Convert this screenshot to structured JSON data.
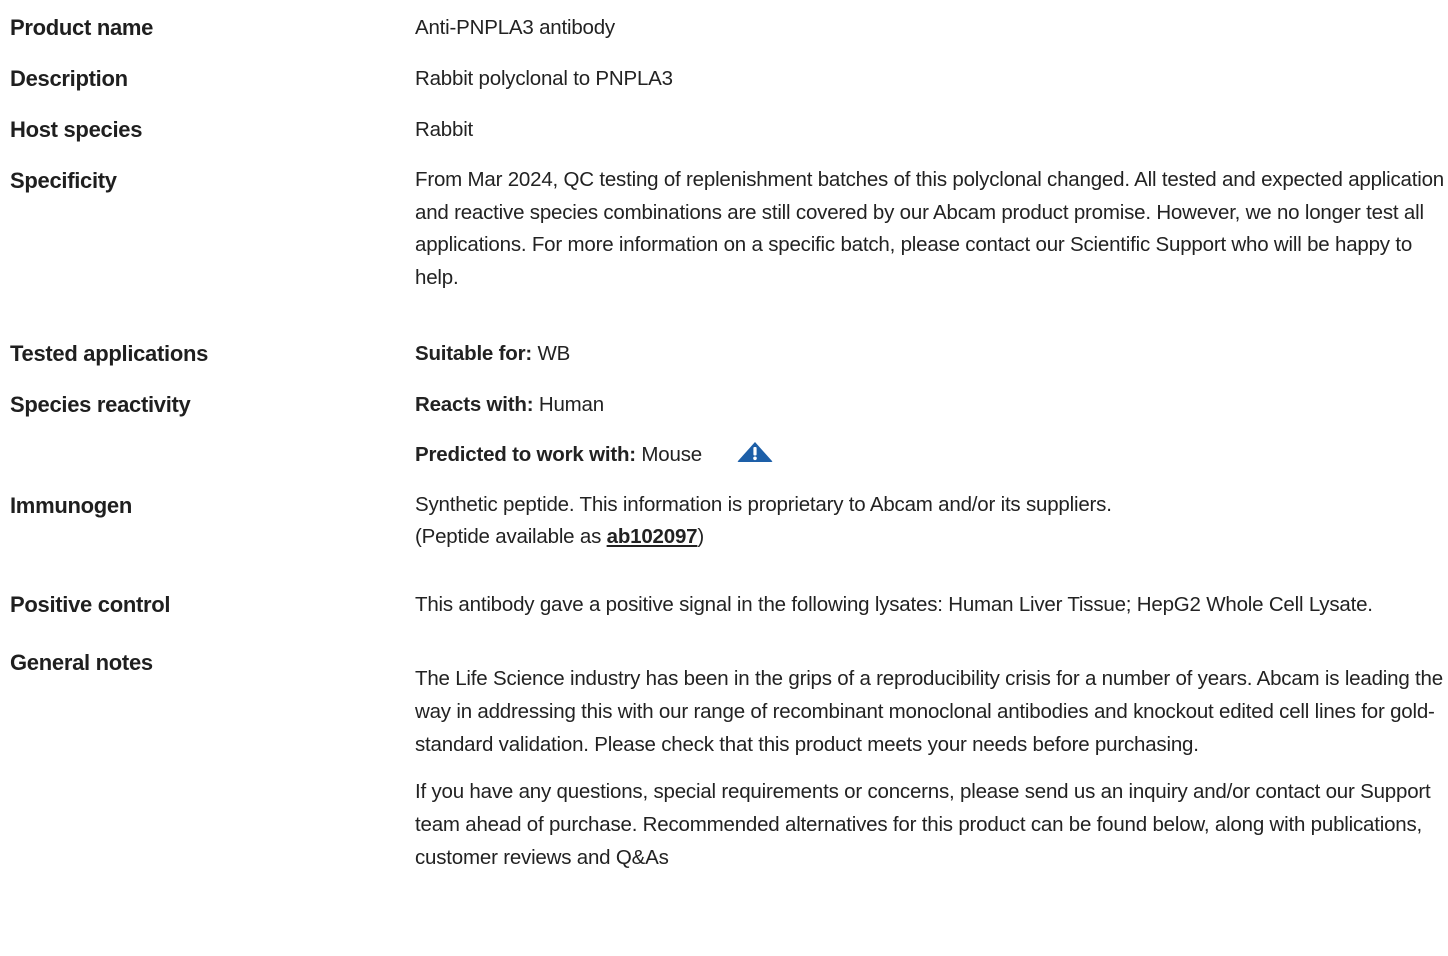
{
  "product_name": {
    "label": "Product name",
    "value": "Anti-PNPLA3 antibody"
  },
  "description": {
    "label": "Description",
    "value": "Rabbit polyclonal to PNPLA3"
  },
  "host_species": {
    "label": "Host species",
    "value": "Rabbit"
  },
  "specificity": {
    "label": "Specificity",
    "value": "From Mar 2024, QC testing of replenishment batches of this polyclonal changed. All tested and expected application and reactive species combinations are still covered by our Abcam product promise. However, we no longer test all applications. For more information on a specific batch, please contact our Scientific Support who will be happy to help."
  },
  "tested_applications": {
    "label": "Tested applications",
    "prefix": "Suitable for:",
    "value": "WB"
  },
  "species_reactivity": {
    "label": "Species reactivity",
    "reacts_prefix": "Reacts with:",
    "reacts_value": "Human",
    "predicted_prefix": "Predicted to work with:",
    "predicted_value": "Mouse",
    "icon": "warning-triangle-icon",
    "icon_color": "#1d5fa8"
  },
  "immunogen": {
    "label": "Immunogen",
    "line1": "Synthetic peptide. This information is proprietary to Abcam and/or its suppliers.",
    "line2_prefix": "(Peptide available as ",
    "link_text": "ab102097",
    "line2_suffix": ")"
  },
  "positive_control": {
    "label": "Positive control",
    "value": "This antibody gave a positive signal in the following lysates: Human Liver Tissue; HepG2 Whole Cell Lysate."
  },
  "general_notes": {
    "label": "General notes",
    "paragraph1": "The Life Science industry has been in the grips of a reproducibility crisis for a number of years. Abcam is leading the way in addressing this with our range of recombinant monoclonal antibodies and knockout edited cell lines for gold-standard validation. Please check that this product meets your needs before purchasing.",
    "paragraph2": "If you have any questions, special requirements or concerns, please send us an inquiry and/or contact our Support team ahead of purchase. Recommended alternatives for this product can be found below, along with publications, customer reviews and Q&As"
  }
}
